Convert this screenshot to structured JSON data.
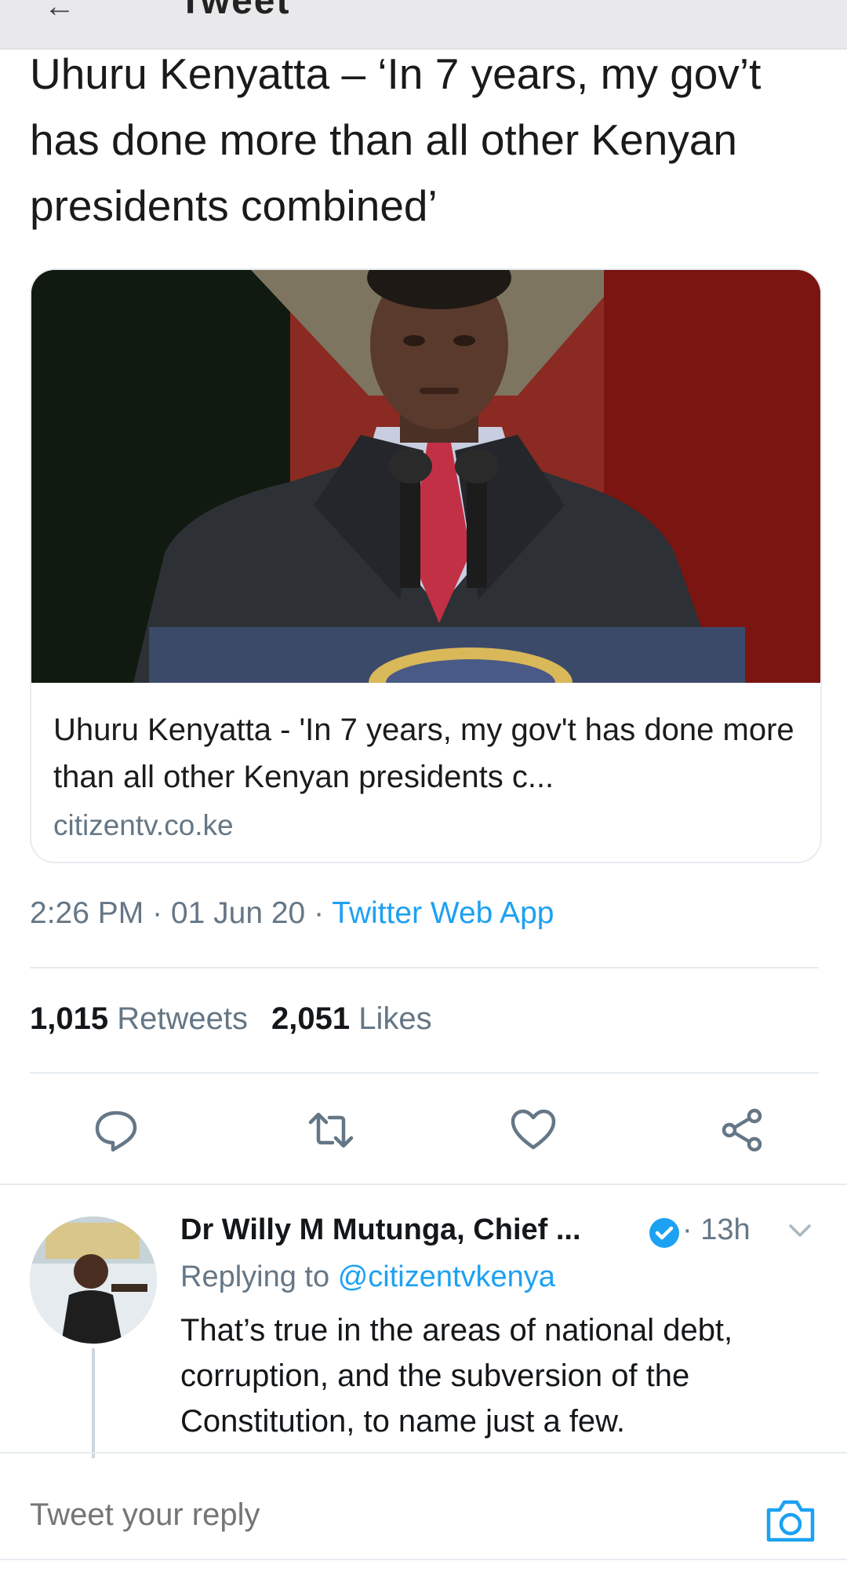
{
  "header": {
    "back_icon": "arrow-left-icon",
    "title": "Tweet"
  },
  "tweet": {
    "text": "Uhuru Kenyatta – ‘In 7 years, my gov’t has done more than all other Kenyan presidents combined’",
    "link_card": {
      "image": "photo of speaker at podium",
      "title": "Uhuru Kenyatta - 'In 7 years, my gov't has done more than all other Kenyan presidents c...",
      "domain": "citizentv.co.ke"
    },
    "time": "2:26 PM",
    "date": "01 Jun 20",
    "source": "Twitter Web App",
    "retweets_count": "1,015",
    "retweets_label": "Retweets",
    "likes_count": "2,051",
    "likes_label": "Likes"
  },
  "actions": [
    "reply-icon",
    "retweet-icon",
    "like-icon",
    "share-icon"
  ],
  "reply": {
    "name": "Dr Willy M Mutunga, Chief ...",
    "verified": true,
    "time": "13h",
    "replying_prefix": "Replying to",
    "replying_handle": "@citizentvkenya",
    "text": "That’s true in the areas of national debt, corruption, and the subversion of the Constitution, to name just a few."
  },
  "composer": {
    "placeholder": "Tweet your reply",
    "camera_icon": "camera-icon"
  },
  "colors": {
    "accent": "#1da1f2",
    "secondary_text": "#657786",
    "divider": "#e6ecf0"
  }
}
